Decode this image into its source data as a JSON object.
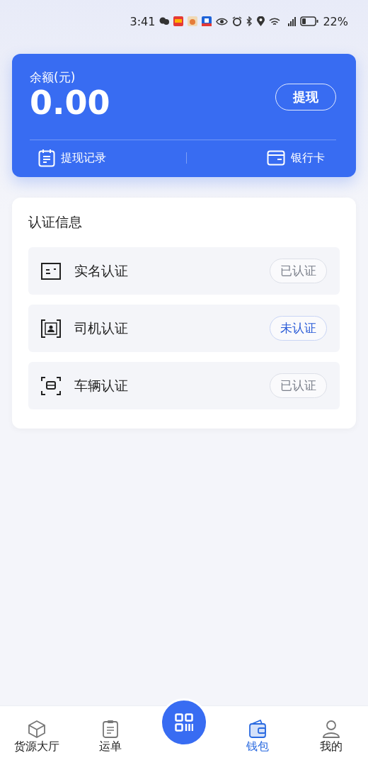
{
  "status_bar": {
    "time": "3:41",
    "battery": "22%"
  },
  "balance": {
    "label": "余额(元)",
    "amount": "0.00",
    "withdraw_button": "提现",
    "links": [
      {
        "kind": "records",
        "label": "提现记录"
      },
      {
        "kind": "bank-card",
        "label": "银行卡"
      }
    ]
  },
  "certification": {
    "title": "认证信息",
    "items": [
      {
        "kind": "id-card",
        "label": "实名认证",
        "verified": true,
        "status": "已认证"
      },
      {
        "kind": "driver",
        "label": "司机认证",
        "verified": false,
        "status": "未认证"
      },
      {
        "kind": "vehicle",
        "label": "车辆认证",
        "verified": true,
        "status": "已认证"
      }
    ]
  },
  "tab_bar": [
    {
      "kind": "box",
      "label": "货源大厅",
      "selected": false
    },
    {
      "kind": "clipboard",
      "label": "运单",
      "selected": false
    },
    {
      "kind": "scan",
      "selected": false
    },
    {
      "kind": "wallet",
      "label": "钱包",
      "selected": true
    },
    {
      "kind": "person",
      "label": "我的",
      "selected": false
    }
  ]
}
